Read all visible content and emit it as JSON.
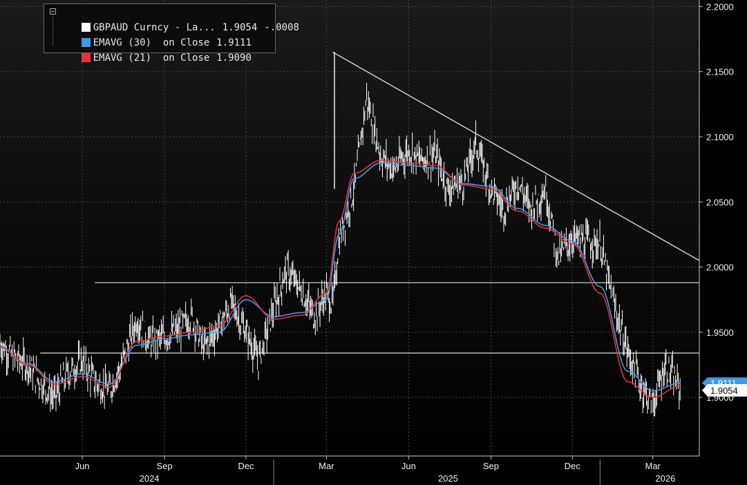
{
  "legend": {
    "rows": [
      {
        "label": "GBPAUD Curncy - La...",
        "value": "1.9054",
        "change": "-.0008",
        "color": "#ffffff"
      },
      {
        "label": "EMAVG (30)  on Close",
        "value": "1.9111",
        "change": "",
        "color": "#3f9be6"
      },
      {
        "label": "EMAVG (21)  on Close",
        "value": "1.9090",
        "change": "",
        "color": "#e8303a"
      }
    ]
  },
  "price_tags": {
    "last": "1.9054",
    "ema30": "1.9111"
  },
  "chart_data": {
    "type": "line",
    "instrument": "GBPAUD Curncy",
    "y_ticks": [
      "2.2000",
      "2.1500",
      "2.1000",
      "2.0500",
      "2.0000",
      "1.9500",
      "1.9000"
    ],
    "ylim": [
      1.855,
      2.205
    ],
    "x_months": [
      "Jun",
      "Sep",
      "Dec",
      "Mar",
      "Jun",
      "Sep",
      "Dec",
      "Mar"
    ],
    "x_years": [
      "2024",
      "2025",
      "2026"
    ],
    "grid": true,
    "colors": {
      "price": "#ffffff",
      "ema30": "#3f9be6",
      "ema21": "#e8303a",
      "trendline": "#d8d8d8"
    },
    "series": [
      {
        "name": "GBPAUD Curncy - La...",
        "x": [
          "2024-03-01",
          "2024-03-15",
          "2024-04-01",
          "2024-04-15",
          "2024-05-01",
          "2024-05-15",
          "2024-06-01",
          "2024-06-15",
          "2024-07-01",
          "2024-07-15",
          "2024-08-01",
          "2024-08-15",
          "2024-09-01",
          "2024-09-15",
          "2024-10-01",
          "2024-10-15",
          "2024-11-01",
          "2024-11-15",
          "2024-12-01",
          "2024-12-15",
          "2025-01-01",
          "2025-01-15",
          "2025-02-01",
          "2025-02-15",
          "2025-03-01",
          "2025-03-08",
          "2025-03-15",
          "2025-04-01",
          "2025-04-15",
          "2025-05-01",
          "2025-05-15",
          "2025-06-01",
          "2025-06-15",
          "2025-07-01",
          "2025-07-15",
          "2025-08-01",
          "2025-08-15",
          "2025-09-01",
          "2025-09-15",
          "2025-10-01",
          "2025-10-15",
          "2025-11-01",
          "2025-11-15",
          "2025-12-01",
          "2025-12-15",
          "2026-01-01",
          "2026-01-15",
          "2026-02-01",
          "2026-02-15",
          "2026-03-01",
          "2026-03-15",
          "2026-04-01"
        ],
        "values": [
          1.942,
          1.931,
          1.925,
          1.912,
          1.9,
          1.918,
          1.928,
          1.912,
          1.905,
          1.925,
          1.96,
          1.943,
          1.946,
          1.951,
          1.962,
          1.938,
          1.955,
          1.972,
          1.95,
          1.928,
          1.968,
          1.998,
          1.982,
          1.962,
          1.98,
          1.97,
          2.02,
          2.06,
          2.13,
          2.085,
          2.075,
          2.09,
          2.082,
          2.086,
          2.06,
          2.065,
          2.095,
          2.06,
          2.045,
          2.065,
          2.045,
          2.06,
          2.008,
          2.022,
          2.02,
          2.018,
          1.975,
          1.935,
          1.91,
          1.895,
          1.925,
          1.9054
        ]
      },
      {
        "name": "EMAVG (30)  on Close",
        "x": [
          "2024-03-01",
          "2024-04-01",
          "2024-05-01",
          "2024-06-01",
          "2024-07-01",
          "2024-08-01",
          "2024-09-01",
          "2024-10-01",
          "2024-11-01",
          "2024-12-01",
          "2025-01-01",
          "2025-02-01",
          "2025-03-01",
          "2025-03-15",
          "2025-04-01",
          "2025-05-01",
          "2025-06-01",
          "2025-07-01",
          "2025-08-01",
          "2025-09-01",
          "2025-10-01",
          "2025-11-01",
          "2025-12-01",
          "2026-01-01",
          "2026-02-01",
          "2026-03-01",
          "2026-04-01"
        ],
        "values": [
          1.938,
          1.926,
          1.912,
          1.918,
          1.91,
          1.94,
          1.945,
          1.948,
          1.95,
          1.975,
          1.962,
          1.965,
          1.975,
          2.025,
          2.068,
          2.08,
          2.078,
          2.076,
          2.064,
          2.062,
          2.045,
          2.032,
          2.02,
          1.985,
          1.92,
          1.905,
          1.9111
        ]
      },
      {
        "name": "EMAVG (21)  on Close",
        "x": [
          "2024-03-01",
          "2024-04-01",
          "2024-05-01",
          "2024-06-01",
          "2024-07-01",
          "2024-08-01",
          "2024-09-01",
          "2024-10-01",
          "2024-11-01",
          "2024-12-01",
          "2025-01-01",
          "2025-02-01",
          "2025-03-01",
          "2025-03-15",
          "2025-04-01",
          "2025-05-01",
          "2025-06-01",
          "2025-07-01",
          "2025-08-01",
          "2025-09-01",
          "2025-10-01",
          "2025-11-01",
          "2025-12-01",
          "2026-01-01",
          "2026-02-01",
          "2026-03-01",
          "2026-04-01"
        ],
        "values": [
          1.939,
          1.925,
          1.91,
          1.916,
          1.908,
          1.943,
          1.947,
          1.95,
          1.955,
          1.978,
          1.96,
          1.963,
          1.98,
          2.035,
          2.072,
          2.082,
          2.08,
          2.078,
          2.063,
          2.06,
          2.043,
          2.03,
          2.018,
          1.98,
          1.912,
          1.9,
          1.909
        ]
      }
    ],
    "trendline": {
      "x": [
        "2025-03-08",
        "2026-04-22"
      ],
      "y": [
        2.165,
        2.005
      ]
    },
    "horizontal_lines": [
      {
        "y": 1.988,
        "x_start": "2024-06-15"
      },
      {
        "y": 1.934,
        "x_start": "2024-04-15"
      }
    ]
  }
}
